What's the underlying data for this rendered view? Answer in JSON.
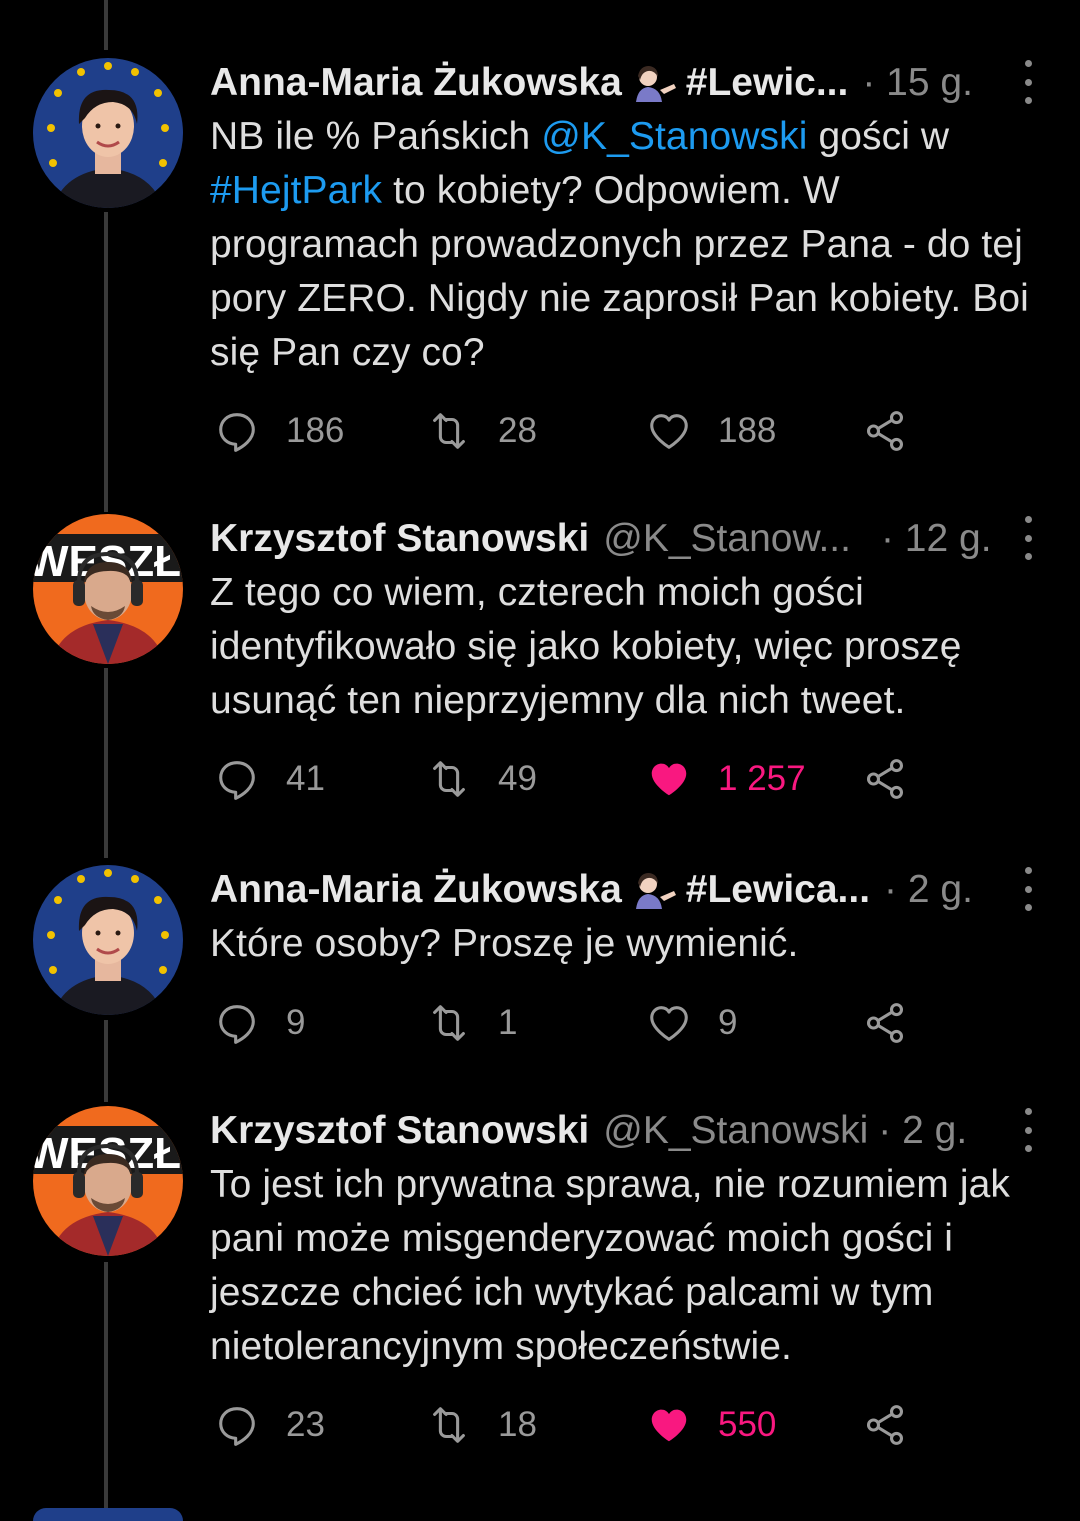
{
  "tweets": [
    {
      "author": "Anna-Maria Żukowska",
      "tag": "#Lewic...",
      "handle": "",
      "time": "· 15 g.",
      "text_parts": [
        {
          "t": "NB ile % Pańskich "
        },
        {
          "t": "@K_Stanowski",
          "link": true
        },
        {
          "t": " gości w "
        },
        {
          "t": "#HejtPark",
          "link": true
        },
        {
          "t": " to kobiety? Odpowiem. W programach prowadzonych przez Pana - do tej pory ZERO. Nigdy nie zaprosił Pan kobiety. Boi się Pan czy co?"
        }
      ],
      "replies": "186",
      "retweets": "28",
      "likes": "188",
      "liked": false
    },
    {
      "author": "Krzysztof Stanowski",
      "tag": "",
      "handle": "@K_Stanow...",
      "time": "· 12 g.",
      "text_parts": [
        {
          "t": "Z tego co wiem, czterech moich gości identyfikowało się jako kobiety, więc proszę usunąć ten nieprzyjemny dla nich tweet."
        }
      ],
      "replies": "41",
      "retweets": "49",
      "likes": "1 257",
      "liked": true
    },
    {
      "author": "Anna-Maria Żukowska",
      "tag": "#Lewica...",
      "handle": "",
      "time": "· 2 g.",
      "text_parts": [
        {
          "t": "Które osoby? Proszę je wymienić."
        }
      ],
      "replies": "9",
      "retweets": "1",
      "likes": "9",
      "liked": false
    },
    {
      "author": "Krzysztof Stanowski",
      "tag": "",
      "handle": "@K_Stanowski",
      "time": "· 2 g.",
      "text_parts": [
        {
          "t": "To jest ich prywatna sprawa, nie rozumiem jak pani może misgenderyzować moich gości i jeszcze chcieć ich wytykać palcami w tym nietolerancyjnym społeczeństwie."
        }
      ],
      "replies": "23",
      "retweets": "18",
      "likes": "550",
      "liked": true
    }
  ],
  "avatar_texts": {
    "stanowski_banner": "WESZŁO"
  },
  "colors": {
    "background": "#000000",
    "link": "#1d9bf0",
    "like_active": "#f91880",
    "muted": "#8a8a8a",
    "text": "#dedede"
  },
  "icons": [
    "reply-icon",
    "retweet-icon",
    "like-icon",
    "share-icon",
    "more-icon",
    "woman-tipping-hand-emoji"
  ]
}
